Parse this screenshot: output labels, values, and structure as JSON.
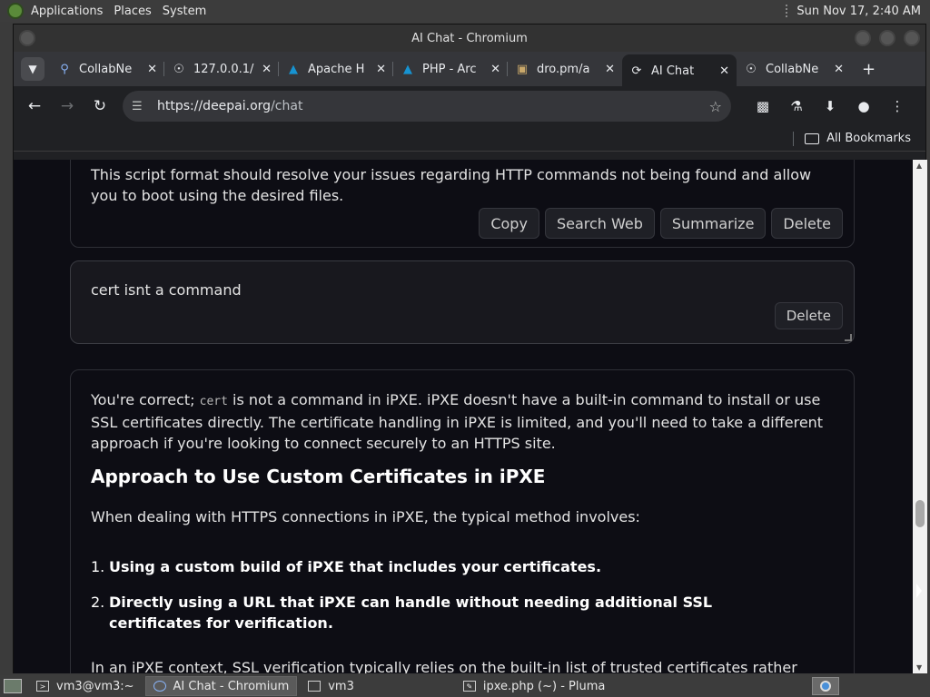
{
  "system_panel": {
    "menus": [
      "Applications",
      "Places",
      "System"
    ],
    "clock": "Sun Nov 17,  2:40 AM"
  },
  "window": {
    "title": "AI Chat - Chromium"
  },
  "tabs": [
    {
      "title": "CollabNe",
      "icon": "search-icon",
      "active": false
    },
    {
      "title": "127.0.0.1/",
      "icon": "globe-icon",
      "active": false
    },
    {
      "title": "Apache H",
      "icon": "arch-logo-icon",
      "active": false
    },
    {
      "title": "PHP - Arc",
      "icon": "arch-logo-icon",
      "active": false
    },
    {
      "title": "dro.pm/a",
      "icon": "folder-icon",
      "active": false
    },
    {
      "title": "AI Chat",
      "icon": "deepai-icon",
      "active": true
    },
    {
      "title": "CollabNe",
      "icon": "globe-icon",
      "active": false
    }
  ],
  "toolbar": {
    "url_host": "https://deepai.org",
    "url_path": "/chat"
  },
  "bookmarks": {
    "all_bookmarks": "All Bookmarks"
  },
  "chat": {
    "msg1": {
      "text": "This script format should resolve your issues regarding HTTP commands not being found and allow you to boot using the desired files.",
      "actions": [
        "Copy",
        "Search Web",
        "Summarize",
        "Delete"
      ]
    },
    "msg2": {
      "text": "cert isnt a command",
      "delete_label": "Delete"
    },
    "msg3": {
      "p1_a": "You're correct; ",
      "p1_code": "cert",
      "p1_b": " is not a command in iPXE. iPXE doesn't have a built-in command to install or use SSL certificates directly. The certificate handling in iPXE is limited, and you'll need to take a different approach if you're looking to connect securely to an HTTPS site.",
      "heading": "Approach to Use Custom Certificates in iPXE",
      "p2": "When dealing with HTTPS connections in iPXE, the typical method involves:",
      "list": [
        {
          "num": "1.",
          "text": "Using a custom build of iPXE that includes your certificates."
        },
        {
          "num": "2.",
          "text": "Directly using a URL that iPXE can handle without needing additional SSL certificates for verification."
        }
      ],
      "p3": "In an iPXE context, SSL verification typically relies on the built-in list of trusted certificates rather than"
    }
  },
  "taskbar": {
    "items": [
      {
        "label": "vm3@vm3:~",
        "active": false
      },
      {
        "label": "AI Chat - Chromium",
        "active": true
      },
      {
        "label": "vm3",
        "active": false
      },
      {
        "label": "ipxe.php (~) - Pluma",
        "active": false
      }
    ]
  }
}
